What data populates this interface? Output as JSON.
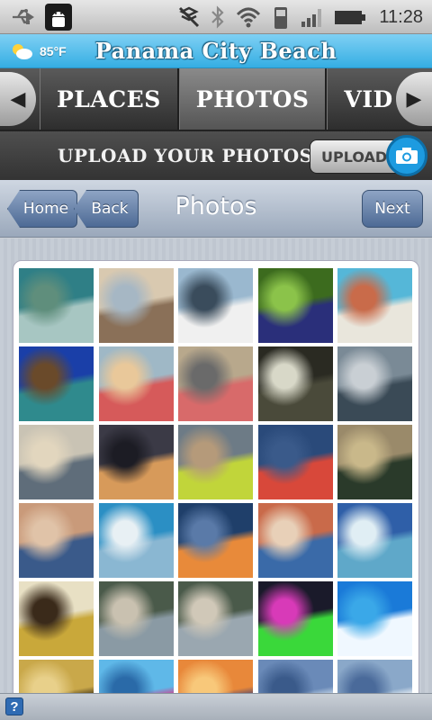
{
  "status_bar": {
    "time": "11:28",
    "icons": [
      "usb-icon",
      "android-debug-icon",
      "vibrate-off-icon",
      "bluetooth-icon",
      "wifi-icon",
      "phone-icon",
      "signal-icon",
      "battery-icon"
    ]
  },
  "title_bar": {
    "temperature": "85°F",
    "weather_icon": "partly-sunny-icon",
    "title": "Panama City Beach"
  },
  "tabs": {
    "items": [
      {
        "label": "PLACES",
        "active": false
      },
      {
        "label": "PHOTOS",
        "active": true
      },
      {
        "label": "VIDEO",
        "active": false
      }
    ]
  },
  "upload_bar": {
    "text": "UPLOAD YOUR PHOTOS",
    "button_label": "UPLOAD"
  },
  "nav": {
    "home_label": "Home",
    "back_label": "Back",
    "title": "Photos",
    "next_label": "Next"
  },
  "photos": [
    {
      "scene": "aerial-marina",
      "colors": [
        "#2f7f86",
        "#a7c6c2",
        "#5f8e7c"
      ]
    },
    {
      "scene": "beach-kids-palm",
      "colors": [
        "#d9c9b0",
        "#8a7058",
        "#a6b7c4"
      ]
    },
    {
      "scene": "man-with-fish",
      "colors": [
        "#9ab8cf",
        "#f0f0f0",
        "#3a4c5c"
      ]
    },
    {
      "scene": "sunglasses-on-grass",
      "colors": [
        "#3c6b1e",
        "#2a2f7a",
        "#8bc34a"
      ]
    },
    {
      "scene": "resort-pool",
      "colors": [
        "#55b7d8",
        "#e9e6dc",
        "#c96b4a"
      ]
    },
    {
      "scene": "pier-blue-sky",
      "colors": [
        "#1a3fa8",
        "#2f8a8d",
        "#6a4a2a"
      ]
    },
    {
      "scene": "girl-at-railing",
      "colors": [
        "#9fb8c6",
        "#d65a5a",
        "#e9c89a"
      ]
    },
    {
      "scene": "kid-on-dock",
      "colors": [
        "#b8a88c",
        "#d86a6a",
        "#6a6a6a"
      ]
    },
    {
      "scene": "night-moon",
      "colors": [
        "#2a2a22",
        "#4a4a3a",
        "#d8d8c8"
      ]
    },
    {
      "scene": "grey-beach",
      "colors": [
        "#7a8a96",
        "#3a4a56",
        "#c9cfd4"
      ]
    },
    {
      "scene": "beach-crowd",
      "colors": [
        "#c9c3b4",
        "#5f6d7a",
        "#e2d6be"
      ]
    },
    {
      "scene": "sunset-boat",
      "colors": [
        "#3b3a46",
        "#d79a5a",
        "#1c1c24"
      ]
    },
    {
      "scene": "boy-green-shorts",
      "colors": [
        "#6d7b86",
        "#c1d53a",
        "#b59a7a"
      ]
    },
    {
      "scene": "boy-red-hat",
      "colors": [
        "#2a4a7a",
        "#d8483a",
        "#3a5a8a"
      ]
    },
    {
      "scene": "palm-dusk",
      "colors": [
        "#9a8a6a",
        "#2a3a2a",
        "#c9b88a"
      ]
    },
    {
      "scene": "girl-selfie",
      "colors": [
        "#c99a7a",
        "#3a5a8a",
        "#e0c3a8"
      ]
    },
    {
      "scene": "dolphin-show",
      "colors": [
        "#2b8fc4",
        "#8ab7d2",
        "#e8f0f4"
      ]
    },
    {
      "scene": "ocean-sunset",
      "colors": [
        "#1f3f6a",
        "#e88a3a",
        "#5a7aa8"
      ]
    },
    {
      "scene": "dad-and-son",
      "colors": [
        "#c96a4a",
        "#3a6aa8",
        "#e8d0b8"
      ]
    },
    {
      "scene": "blue-sea",
      "colors": [
        "#2f5fa8",
        "#5fa8c9",
        "#e0eef4"
      ]
    },
    {
      "scene": "cup-closeup",
      "colors": [
        "#e8e0c4",
        "#c9a83a",
        "#3a2a1a"
      ]
    },
    {
      "scene": "beach-houses",
      "colors": [
        "#4a5a4a",
        "#8a9aa4",
        "#c9c1b0"
      ]
    },
    {
      "scene": "beach-houses-2",
      "colors": [
        "#4a5a4a",
        "#9aa7b0",
        "#d0c8b8"
      ]
    },
    {
      "scene": "ride-lights",
      "colors": [
        "#1a1a2a",
        "#3ad83a",
        "#d83ab8"
      ]
    },
    {
      "scene": "orca-pool",
      "colors": [
        "#1a7ad8",
        "#f0f8ff",
        "#3aa8e8"
      ]
    },
    {
      "scene": "jar-closeup",
      "colors": [
        "#c9a84a",
        "#4a3a1a",
        "#e8d08a"
      ]
    },
    {
      "scene": "dolphins-jump",
      "colors": [
        "#5fb8e8",
        "#d83a8a",
        "#2a6aa8"
      ]
    },
    {
      "scene": "sunset-sky",
      "colors": [
        "#e8883a",
        "#5a4a6a",
        "#f8c87a"
      ]
    },
    {
      "scene": "cloud-sea",
      "colors": [
        "#6a8ab8",
        "#c9d8e8",
        "#3a5a8a"
      ]
    },
    {
      "scene": "bright-sun",
      "colors": [
        "#8aa8c9",
        "#f0f4f8",
        "#4a6a9a"
      ]
    }
  ],
  "bottom_bar": {
    "help_label": "?"
  }
}
